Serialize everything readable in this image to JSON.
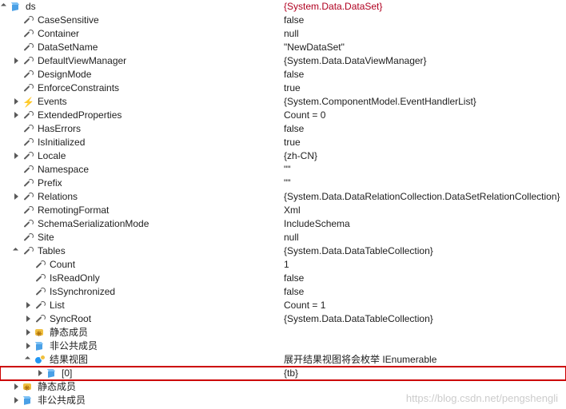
{
  "watermark": "https://blog.csdn.net/pengshengli",
  "rows": [
    {
      "d": 0,
      "exp": "open",
      "ico": "cube",
      "name": "ds",
      "val": "{System.Data.DataSet}",
      "valRed": true,
      "inter": true
    },
    {
      "d": 1,
      "exp": "none",
      "ico": "wrench",
      "name": "CaseSensitive",
      "val": "false"
    },
    {
      "d": 1,
      "exp": "none",
      "ico": "wrench",
      "name": "Container",
      "val": "null"
    },
    {
      "d": 1,
      "exp": "none",
      "ico": "wrench",
      "name": "DataSetName",
      "val": "\"NewDataSet\""
    },
    {
      "d": 1,
      "exp": "closed",
      "ico": "wrench",
      "name": "DefaultViewManager",
      "val": "{System.Data.DataViewManager}",
      "inter": true
    },
    {
      "d": 1,
      "exp": "none",
      "ico": "wrench",
      "name": "DesignMode",
      "val": "false"
    },
    {
      "d": 1,
      "exp": "none",
      "ico": "wrench",
      "name": "EnforceConstraints",
      "val": "true"
    },
    {
      "d": 1,
      "exp": "closed",
      "ico": "lightning",
      "name": "Events",
      "val": "{System.ComponentModel.EventHandlerList}",
      "inter": true
    },
    {
      "d": 1,
      "exp": "closed",
      "ico": "wrench",
      "name": "ExtendedProperties",
      "val": "Count = 0",
      "inter": true
    },
    {
      "d": 1,
      "exp": "none",
      "ico": "wrench",
      "name": "HasErrors",
      "val": "false"
    },
    {
      "d": 1,
      "exp": "none",
      "ico": "wrench",
      "name": "IsInitialized",
      "val": "true"
    },
    {
      "d": 1,
      "exp": "closed",
      "ico": "wrench",
      "name": "Locale",
      "val": "{zh-CN}",
      "inter": true
    },
    {
      "d": 1,
      "exp": "none",
      "ico": "wrench",
      "name": "Namespace",
      "val": "\"\""
    },
    {
      "d": 1,
      "exp": "none",
      "ico": "wrench",
      "name": "Prefix",
      "val": "\"\""
    },
    {
      "d": 1,
      "exp": "closed",
      "ico": "wrench",
      "name": "Relations",
      "val": "{System.Data.DataRelationCollection.DataSetRelationCollection}",
      "inter": true
    },
    {
      "d": 1,
      "exp": "none",
      "ico": "wrench",
      "name": "RemotingFormat",
      "val": "Xml"
    },
    {
      "d": 1,
      "exp": "none",
      "ico": "wrench",
      "name": "SchemaSerializationMode",
      "val": "IncludeSchema"
    },
    {
      "d": 1,
      "exp": "none",
      "ico": "wrench",
      "name": "Site",
      "val": "null"
    },
    {
      "d": 1,
      "exp": "open",
      "ico": "wrench",
      "name": "Tables",
      "val": "{System.Data.DataTableCollection}",
      "inter": true
    },
    {
      "d": 2,
      "exp": "none",
      "ico": "wrench",
      "name": "Count",
      "val": "1"
    },
    {
      "d": 2,
      "exp": "none",
      "ico": "wrench",
      "name": "IsReadOnly",
      "val": "false"
    },
    {
      "d": 2,
      "exp": "none",
      "ico": "wrench",
      "name": "IsSynchronized",
      "val": "false"
    },
    {
      "d": 2,
      "exp": "closed",
      "ico": "wrench",
      "name": "List",
      "val": "Count = 1",
      "inter": true
    },
    {
      "d": 2,
      "exp": "closed",
      "ico": "wrench",
      "name": "SyncRoot",
      "val": "{System.Data.DataTableCollection}",
      "inter": true
    },
    {
      "d": 2,
      "exp": "closed",
      "ico": "static",
      "name": "静态成员",
      "val": "",
      "inter": true
    },
    {
      "d": 2,
      "exp": "closed",
      "ico": "cube",
      "name": "非公共成员",
      "val": "",
      "inter": true
    },
    {
      "d": 2,
      "exp": "open",
      "ico": "result",
      "name": "结果视图",
      "val": "展开结果视图将会枚举 IEnumerable",
      "inter": true
    },
    {
      "d": 3,
      "exp": "closed",
      "ico": "cube",
      "name": "[0]",
      "val": "{tb}",
      "inter": true,
      "boxed": true
    },
    {
      "d": 1,
      "exp": "closed",
      "ico": "static",
      "name": "静态成员",
      "val": "",
      "inter": true
    },
    {
      "d": 1,
      "exp": "closed",
      "ico": "cube",
      "name": "非公共成员",
      "val": "",
      "inter": true
    }
  ]
}
